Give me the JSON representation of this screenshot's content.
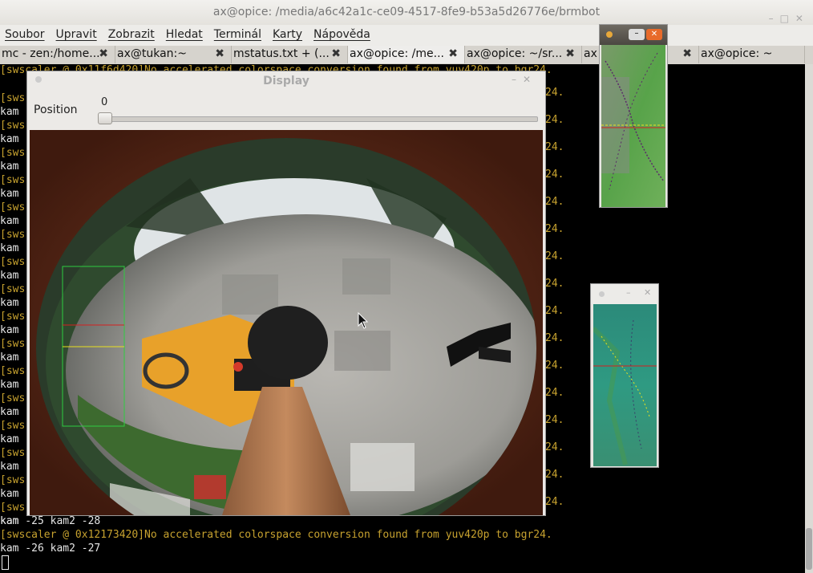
{
  "window": {
    "title": "ax@opice: /media/a6c42a1c-ce09-4517-8fe9-b53a5d26776e/brmbot"
  },
  "menu": [
    "Soubor",
    "Upravit",
    "Zobrazit",
    "Hledat",
    "Terminál",
    "Karty",
    "Nápověda"
  ],
  "tabs": [
    {
      "label": "mc - zen:/home..."
    },
    {
      "label": "ax@tukan:~"
    },
    {
      "label": "mstatus.txt + (..."
    },
    {
      "label": "ax@opice: /me..."
    },
    {
      "label": "ax@opice: ~/sr..."
    },
    {
      "label": "ax"
    },
    {
      "label": "ax@opice: ~"
    }
  ],
  "terminal": {
    "partial_prefix_yellow": "[sws",
    "partial_prefix_white": "kam ",
    "partial_suffix": "24.",
    "top_clipped_line": "[swscaler @ 0x11f6d420]No accelerated colorspace conversion found from yuv420p to bgr24.",
    "line1": "kam -25 kam2 -28",
    "line2": "[swscaler @ 0x12173420]No accelerated colorspace conversion found from yuv420p to bgr24.",
    "line3": "kam -26 kam2 -27"
  },
  "display": {
    "title": "Display",
    "position_label": "Position",
    "position_value": "0"
  },
  "colors": {
    "terminal_yellow": "#c7a22f",
    "terminal_white": "#e6e6e6",
    "roi_green": "#2ecc40"
  }
}
